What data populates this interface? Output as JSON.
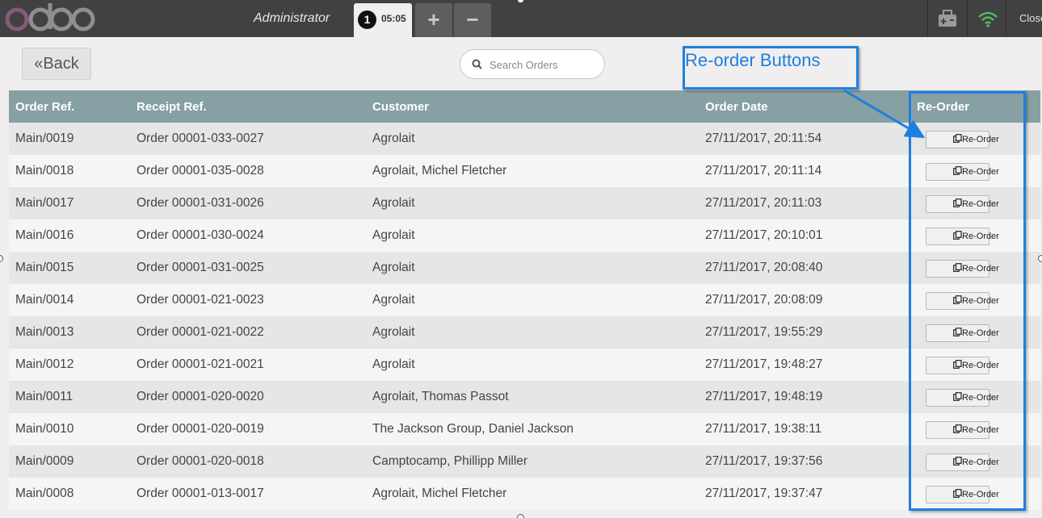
{
  "header": {
    "logo_text": "odoo",
    "cashier": "Administrator",
    "order_tab": {
      "sequence": "1",
      "time": "05:05"
    },
    "add_tab": "+",
    "remove_tab": "−",
    "close_label": "Close"
  },
  "controls": {
    "back_label": "Back",
    "search_placeholder": "Search Orders"
  },
  "table": {
    "columns": [
      "Order Ref.",
      "Receipt Ref.",
      "Customer",
      "Order Date",
      "Re-Order"
    ],
    "rows": [
      [
        "Main/0019",
        "Order 00001-033-0027",
        "Agrolait",
        "27/11/2017, 20:11:54"
      ],
      [
        "Main/0018",
        "Order 00001-035-0028",
        "Agrolait, Michel Fletcher",
        "27/11/2017, 20:11:14"
      ],
      [
        "Main/0017",
        "Order 00001-031-0026",
        "Agrolait",
        "27/11/2017, 20:11:03"
      ],
      [
        "Main/0016",
        "Order 00001-030-0024",
        "Agrolait",
        "27/11/2017, 20:10:01"
      ],
      [
        "Main/0015",
        "Order 00001-031-0025",
        "Agrolait",
        "27/11/2017, 20:08:40"
      ],
      [
        "Main/0014",
        "Order 00001-021-0023",
        "Agrolait",
        "27/11/2017, 20:08:09"
      ],
      [
        "Main/0013",
        "Order 00001-021-0022",
        "Agrolait",
        "27/11/2017, 19:55:29"
      ],
      [
        "Main/0012",
        "Order 00001-021-0021",
        "Agrolait",
        "27/11/2017, 19:48:27"
      ],
      [
        "Main/0011",
        "Order 00001-020-0020",
        "Agrolait, Thomas Passot",
        "27/11/2017, 19:48:19"
      ],
      [
        "Main/0010",
        "Order 00001-020-0019",
        "The Jackson Group, Daniel Jackson",
        "27/11/2017, 19:38:11"
      ],
      [
        "Main/0009",
        "Order 00001-020-0018",
        "Camptocamp, Phillipp Miller",
        "27/11/2017, 19:37:56"
      ],
      [
        "Main/0008",
        "Order 00001-013-0017",
        "Agrolait, Michel Fletcher",
        "27/11/2017, 19:37:47"
      ]
    ],
    "reorder_button_label": "Re-Order"
  },
  "annotation": {
    "text": "Re-order Buttons",
    "color": "#1e7fe0"
  },
  "icons": {
    "back": "double-chevron-left-icon",
    "search": "search-icon",
    "reorder": "copy-icon",
    "proxy": "printer-icon",
    "sync": "wifi-icon"
  },
  "colors": {
    "topbar": "#414141",
    "table_header": "#87a0a3",
    "background": "#f0eeee",
    "wifi": "#5cb85c"
  }
}
